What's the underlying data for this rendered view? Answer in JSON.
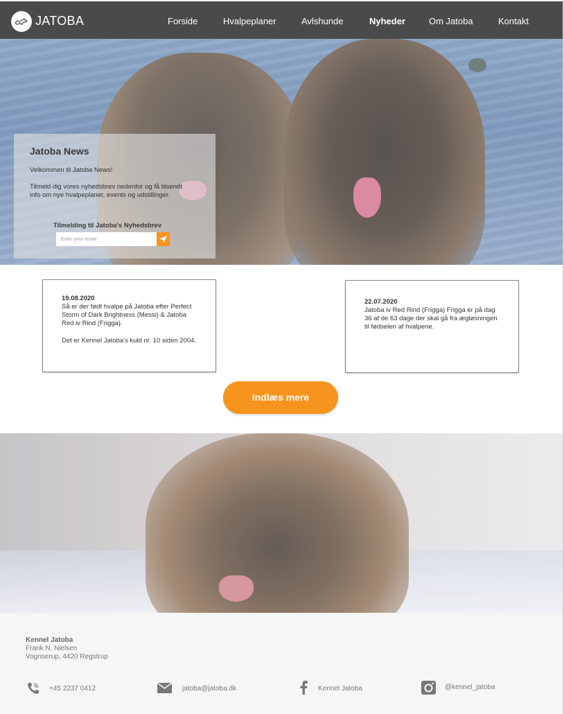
{
  "brand": {
    "name": "JATOBA"
  },
  "nav": {
    "items": [
      {
        "label": "Forside",
        "active": false
      },
      {
        "label": "Hvalpeplaner",
        "active": false
      },
      {
        "label": "Avlshunde",
        "active": false
      },
      {
        "label": "Nyheder",
        "active": true
      },
      {
        "label": "Om Jatoba",
        "active": false
      },
      {
        "label": "Kontakt",
        "active": false
      }
    ]
  },
  "hero": {
    "title": "Jatoba News",
    "welcome": "Velkommen til Jatoba News!",
    "text": "Tilmeld dig vores nyhedsbrev nedenfor og få tilsendt info om nye hvalpeplaner, events og udstillinger.",
    "signup_label": "Tilmelding til Jatoba's Nyhedsbrev",
    "email_placeholder": "Enter your email",
    "send_icon": "paper-plane-icon"
  },
  "posts": [
    {
      "date": "19.08.2020",
      "body": "Så er der født hvalpe på Jatoba efter Perfect Storm of Dark Brightness (Messi) & Jatoba Red iv Rind (Frigga).",
      "body2": "Det er Kennel Jatoba's kuld nr. 10 siden 2004."
    },
    {
      "date": "22.07.2020",
      "body": "Jatoba iv Red Rind (Frigga) Frigga er på dag 36 af de 63 dage der skal gå fra ægløsningen til fødselen af hvalpene."
    }
  ],
  "load_more_label": "Indlæs mere",
  "footer": {
    "name": "Kennel Jatoba",
    "owner": "Frank N. Nielsen",
    "address": "Vognserup, 4420 Regstrup",
    "phone": "+45 2237 0412",
    "email": "jatoba@jatoba.dk",
    "facebook": "Kennel Jatoba",
    "instagram": "@kennel_jatoba"
  },
  "colors": {
    "nav_bg": "#4a4a4a",
    "accent": "#f7941d",
    "footer_bg": "#f6f6f6"
  }
}
